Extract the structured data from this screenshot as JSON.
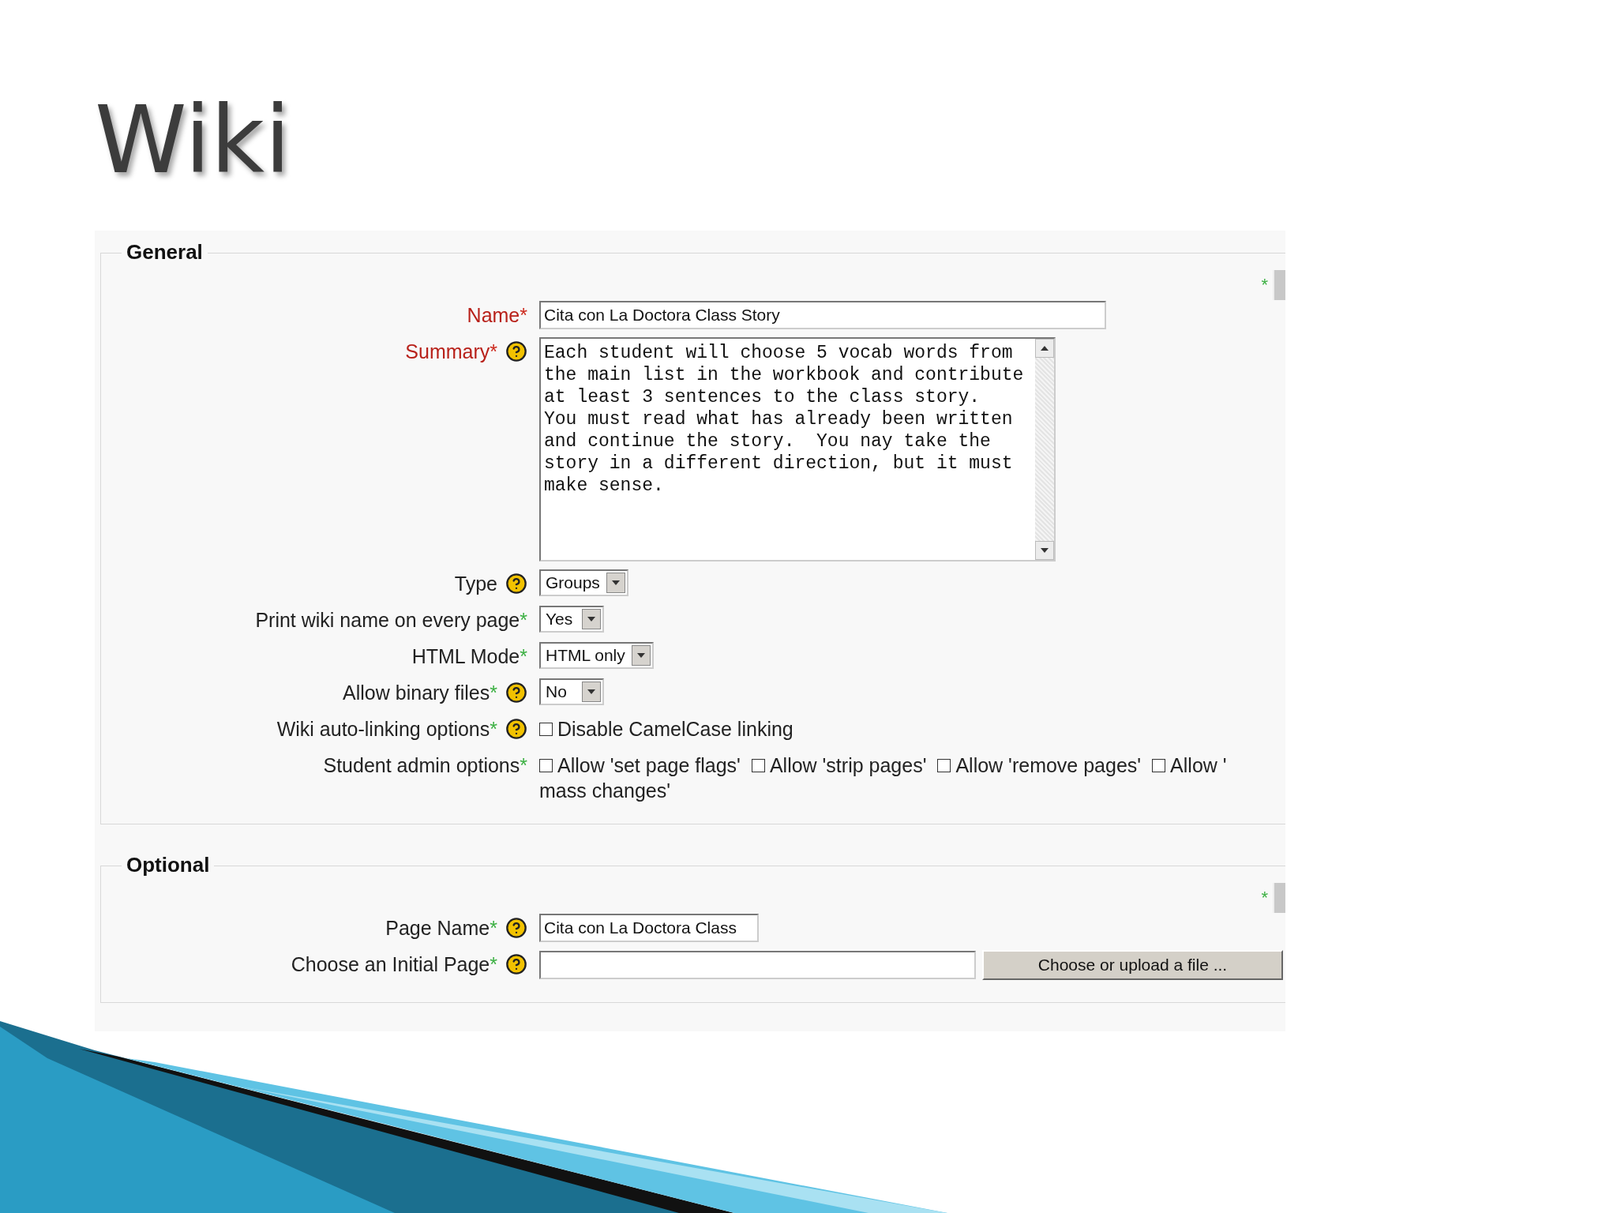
{
  "slide": {
    "title": "Wiki"
  },
  "sections": [
    {
      "legend": "General",
      "marker": "*",
      "fields": [
        {
          "kind": "line",
          "label": "Name",
          "required": true,
          "highlighted": true,
          "help": false,
          "value": "Cita con La Doctora Class Story"
        },
        {
          "kind": "textarea",
          "label": "Summary",
          "required": true,
          "highlighted": true,
          "help": true,
          "value": "Each student will choose 5 vocab words from the main list in the workbook and contribute at least 3 sentences to the class story.\nYou must read what has already been written and continue the story.  You nay take the story in a different direction, but it must make sense."
        },
        {
          "kind": "select",
          "label": "Type",
          "required": false,
          "highlighted": false,
          "help": true,
          "value": "Groups"
        },
        {
          "kind": "select",
          "label": "Print wiki name on every page",
          "required": true,
          "highlighted": false,
          "help": false,
          "value": "Yes"
        },
        {
          "kind": "select",
          "label": "HTML Mode",
          "required": true,
          "highlighted": false,
          "help": false,
          "value": "HTML only"
        },
        {
          "kind": "select",
          "label": "Allow binary files",
          "required": true,
          "highlighted": false,
          "help": true,
          "value": "No"
        },
        {
          "kind": "checkgroup",
          "label": "Wiki auto-linking options",
          "required": true,
          "highlighted": false,
          "help": true,
          "options": [
            {
              "label": "Disable CamelCase linking",
              "checked": false
            }
          ]
        },
        {
          "kind": "checkgroup",
          "label": "Student admin options",
          "required": true,
          "highlighted": false,
          "help": false,
          "options": [
            {
              "label": "Allow 'set page flags'",
              "checked": false
            },
            {
              "label": "Allow 'strip pages'",
              "checked": false
            },
            {
              "label": "Allow 'remove pages'",
              "checked": false
            },
            {
              "label": "Allow '",
              "checked": false
            }
          ],
          "continuation": "mass changes'"
        }
      ]
    },
    {
      "legend": "Optional",
      "marker": "*",
      "fields": [
        {
          "kind": "shortline",
          "label": "Page Name",
          "required": true,
          "highlighted": false,
          "help": true,
          "value": "Cita con La Doctora Class"
        },
        {
          "kind": "file",
          "label": "Choose an Initial Page",
          "required": true,
          "highlighted": false,
          "help": true,
          "button": "Choose or upload a file ..."
        }
      ]
    }
  ]
}
